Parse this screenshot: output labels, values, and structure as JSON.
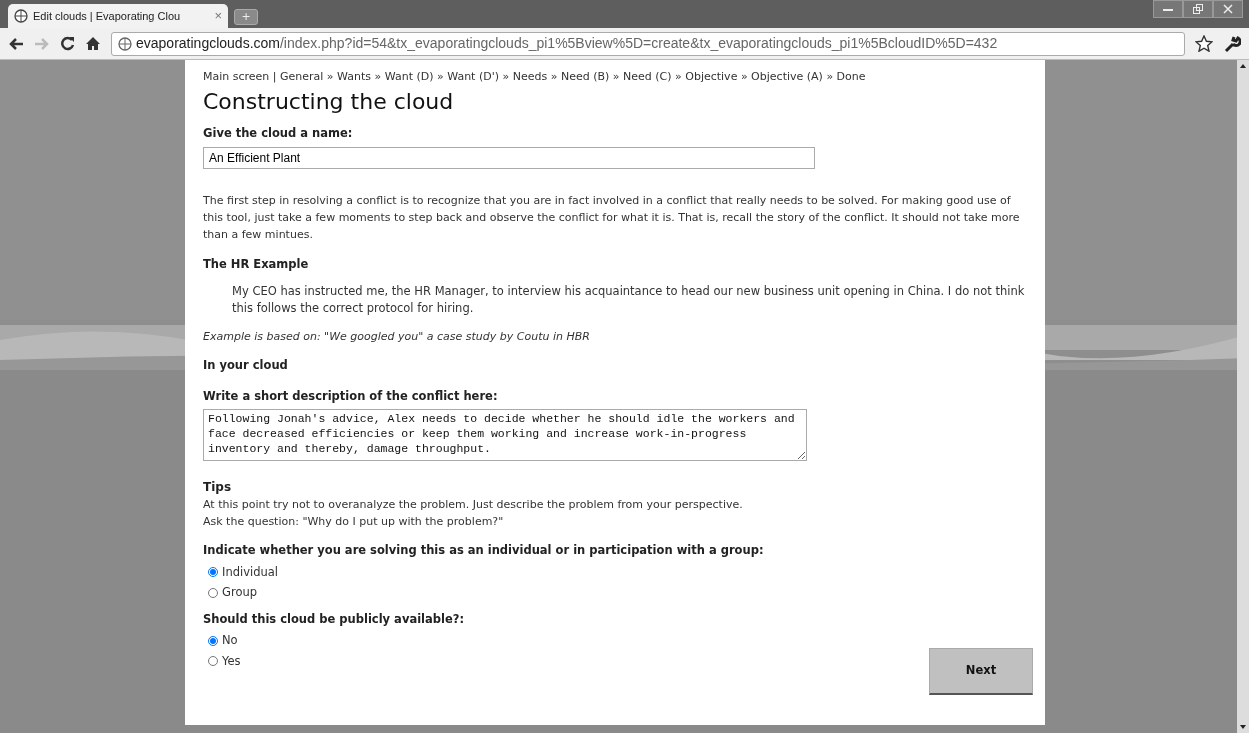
{
  "browser": {
    "tab": {
      "title": "Edit clouds | Evaporating Clou",
      "close": "×"
    },
    "new_tab": "+",
    "url_host": "evaporatingclouds.com",
    "url_path": "/index.php?id=54&tx_evaporatingclouds_pi1%5Bview%5D=create&tx_evaporatingclouds_pi1%5BcloudID%5D=432",
    "forward_disabled": true
  },
  "page": {
    "breadcrumb": "Main screen | General » Wants » Want (D) » Want (D') » Needs » Need (B) » Need (C) » Objective » Objective (A) » Done",
    "heading": "Constructing the cloud",
    "name_label": "Give the cloud a name:",
    "name_value": "An Efficient Plant",
    "intro": "The first step in resolving a conflict is to recognize that you are in fact involved in a conflict that really needs to be solved. For making good use of this tool, just take a few moments to step back and observe the conflict for what it is. That is, recall the story of the conflict. It should not take more than a few mintues.",
    "example_heading": "The HR Example",
    "example_quote": "My CEO has instructed me, the HR Manager, to interview his acquaintance to head our new business unit opening in China. I do not think this follows the correct protocol for hiring.",
    "example_source": "Example is based on: \"We googled you\" a case study by Coutu in HBR",
    "cloud_heading": "In your cloud",
    "description_label": "Write a short description of the conflict here:",
    "description_value": "Following Jonah's advice, Alex needs to decide whether he should idle the workers and face decreased efficiencies or keep them working and increase work-in-progress inventory and thereby, damage throughput.",
    "tips_heading": "Tips",
    "tips": [
      "At this point try not to overanalyze the problem. Just describe the problem from your perspective.",
      "Ask the question: \"Why do I put up with the problem?\""
    ],
    "radio_groups": [
      {
        "label": "Indicate whether you are solving this as an individual or in participation with a group:",
        "options": [
          {
            "label": "Individual",
            "selected": true
          },
          {
            "label": "Group",
            "selected": false
          }
        ]
      },
      {
        "label": "Should this cloud be publicly available?:",
        "options": [
          {
            "label": "No",
            "selected": true
          },
          {
            "label": "Yes",
            "selected": false
          }
        ]
      }
    ],
    "next_button": "Next"
  }
}
